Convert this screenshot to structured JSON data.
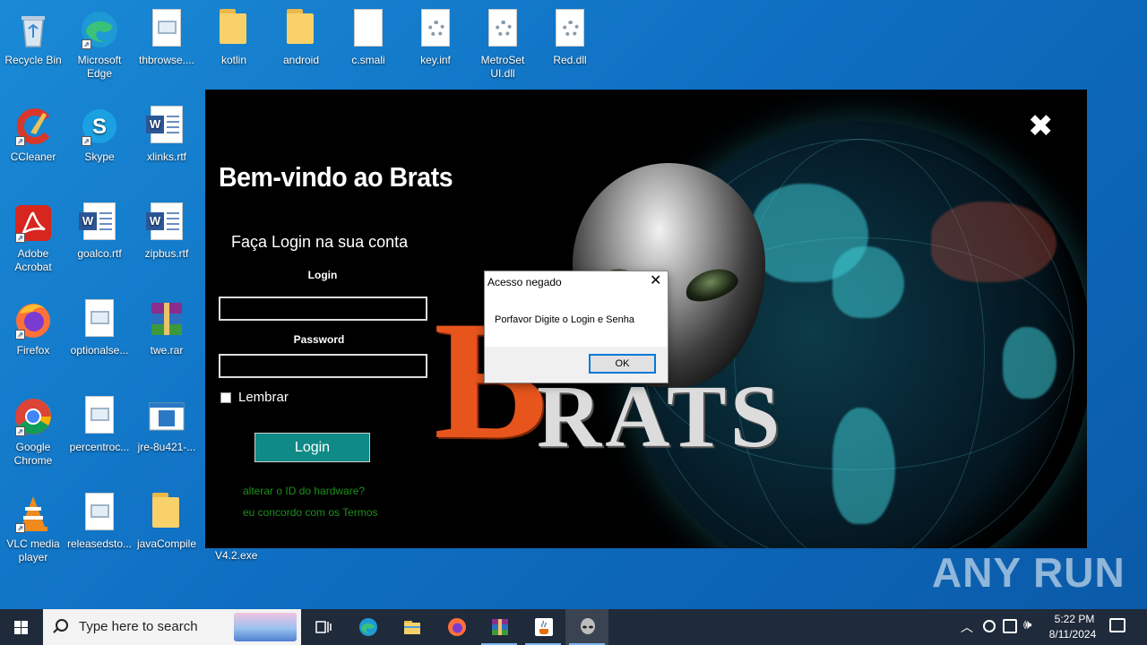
{
  "desktop": {
    "icons": [
      {
        "label": "Recycle Bin"
      },
      {
        "label": "Microsoft Edge"
      },
      {
        "label": "thbrowse...."
      },
      {
        "label": "kotlin"
      },
      {
        "label": "android"
      },
      {
        "label": "c.smali"
      },
      {
        "label": "key.inf"
      },
      {
        "label": "MetroSet UI.dll"
      },
      {
        "label": "Red.dll"
      },
      {
        "label": "CCleaner"
      },
      {
        "label": "Skype"
      },
      {
        "label": "xlinks.rtf"
      },
      {
        "label": "Adobe Acrobat"
      },
      {
        "label": "goalco.rtf"
      },
      {
        "label": "zipbus.rtf"
      },
      {
        "label": "Firefox"
      },
      {
        "label": "optionalse..."
      },
      {
        "label": "twe.rar"
      },
      {
        "label": "Google Chrome"
      },
      {
        "label": "percentroc..."
      },
      {
        "label": "jre-8u421-..."
      },
      {
        "label": "VLC media player"
      },
      {
        "label": "releasedsto..."
      },
      {
        "label": "javaCompile"
      }
    ],
    "exe_label": "V4.2.exe"
  },
  "brats": {
    "welcome": "Bem-vindo ao Brats",
    "subtitle": "Faça Login na sua conta",
    "login_label": "Login",
    "password_label": "Password",
    "remember_label": "Lembrar",
    "login_button": "Login",
    "link_hwid": "alterar o ID do hardware?",
    "link_terms": "eu concordo com os Termos",
    "logo_b": "B",
    "logo_rest": "RATS",
    "close_glyph": "✖"
  },
  "dialog": {
    "title": "Acesso negado",
    "message": "Porfavor Digite o Login e Senha",
    "ok_label": "OK",
    "close_glyph": "✕"
  },
  "watermark": "ANY RUN",
  "taskbar": {
    "search_placeholder": "Type here to search",
    "time": "5:22 PM",
    "date": "8/11/2024",
    "apps": [
      "task-view",
      "edge",
      "file-explorer",
      "firefox",
      "winrar",
      "java",
      "brats"
    ]
  }
}
